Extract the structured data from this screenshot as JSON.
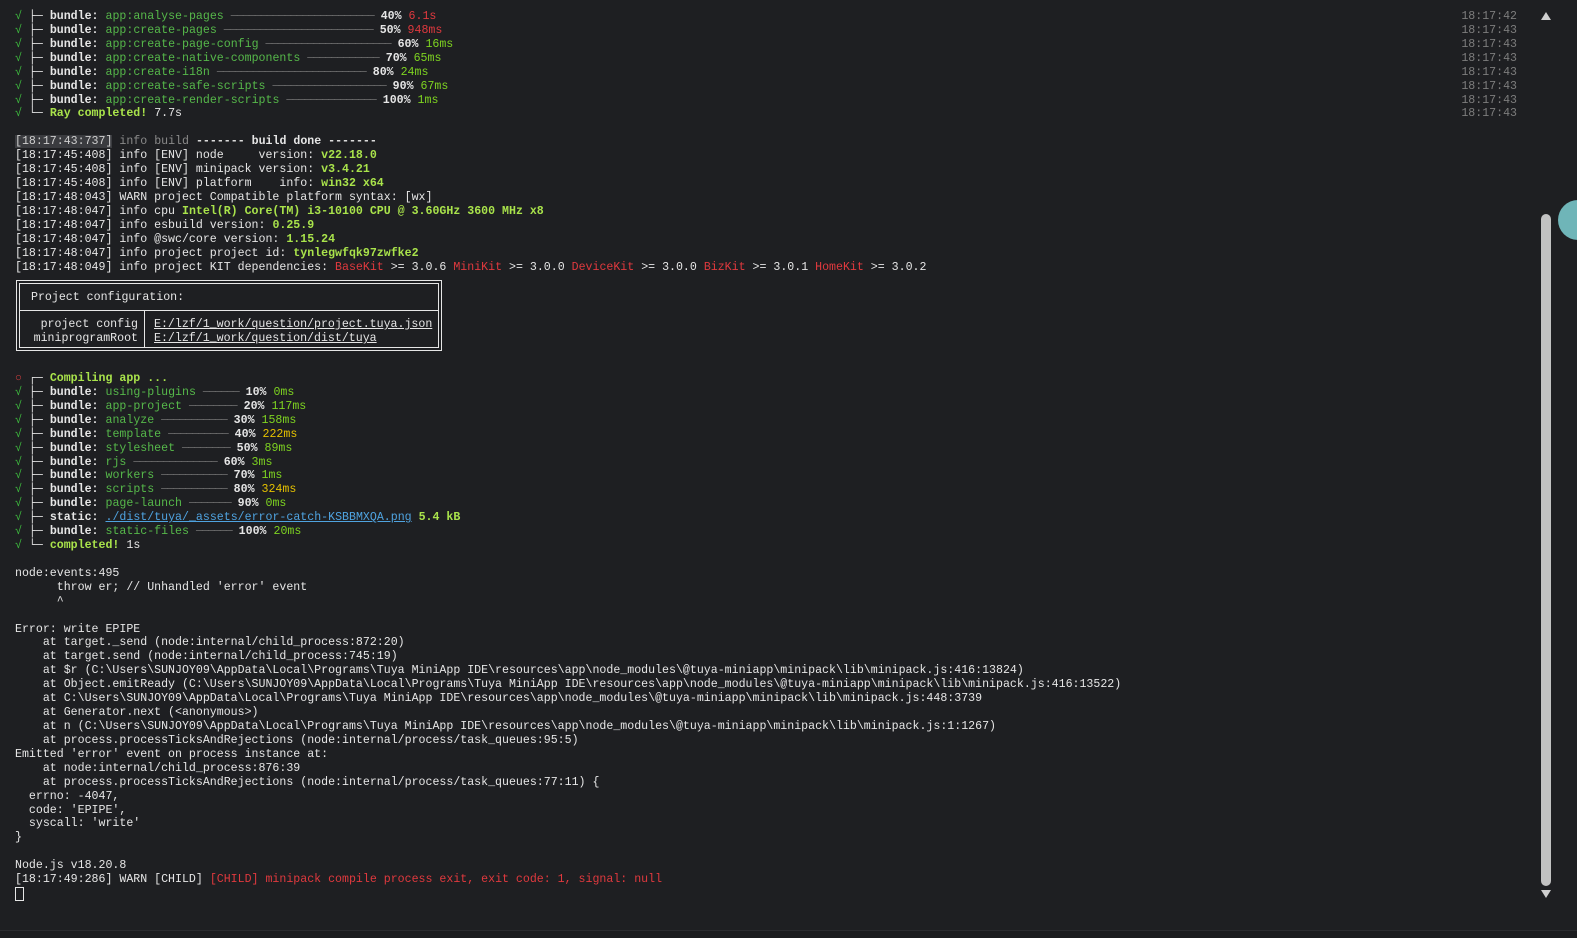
{
  "colors": {
    "background": "#1e1f22",
    "success": "#3fbf3f",
    "package": "#56b84a",
    "fast": "#7ed321",
    "medium": "#e5c100",
    "slow": "#e0393e",
    "timestamp": "#7d7d7d"
  },
  "icons": {
    "success": "√",
    "pending": "○",
    "scroll_up": "triangle-up-icon",
    "scroll_down": "triangle-down-icon"
  },
  "top_bundles": [
    {
      "label": "bundle:",
      "name": "app:analyse-pages",
      "bar": "────────────────────────",
      "pct": "40%",
      "time": "6.1s",
      "speed": "slow",
      "ts": "18:17:42"
    },
    {
      "label": "bundle:",
      "name": "app:create-pages",
      "bar": "─────────────────────────",
      "pct": "50%",
      "time": "948ms",
      "speed": "slow",
      "ts": "18:17:43"
    },
    {
      "label": "bundle:",
      "name": "app:create-page-config",
      "bar": "─────────────────────",
      "pct": "60%",
      "time": "16ms",
      "speed": "fast",
      "ts": "18:17:43"
    },
    {
      "label": "bundle:",
      "name": "app:create-native-components",
      "bar": "────────────",
      "pct": "70%",
      "time": "65ms",
      "speed": "fast",
      "ts": "18:17:43"
    },
    {
      "label": "bundle:",
      "name": "app:create-i18n",
      "bar": "─────────────────────────",
      "pct": "80%",
      "time": "24ms",
      "speed": "fast",
      "ts": "18:17:43"
    },
    {
      "label": "bundle:",
      "name": "app:create-safe-scripts",
      "bar": "───────────────────",
      "pct": "90%",
      "time": "67ms",
      "speed": "fast",
      "ts": "18:17:43"
    },
    {
      "label": "bundle:",
      "name": "app:create-render-scripts",
      "bar": "───────────────",
      "pct": "100%",
      "time": "1ms",
      "speed": "fast",
      "ts": "18:17:43"
    }
  ],
  "ray_completed": {
    "text": "Ray completed!",
    "time": "7.7s",
    "ts": "18:17:43"
  },
  "log_build_done": {
    "stamp": "[18:17:43:737]",
    "level": "info",
    "tag": "build",
    "msg": "------- build done -------"
  },
  "env_logs": [
    {
      "prefix": "[18:17:45:408] info [ENV] node     version: ",
      "value": "v22.18.0"
    },
    {
      "prefix": "[18:17:45:408] info [ENV] minipack version: ",
      "value": "v3.4.21"
    },
    {
      "prefix": "[18:17:45:408] info [ENV] platform    info: ",
      "value": "win32 x64"
    },
    {
      "prefix": "[18:17:48:043] WARN project Compatible platform syntax: [wx]",
      "value": ""
    },
    {
      "prefix": "[18:17:48:047] info cpu ",
      "value": "Intel(R) Core(TM) i3-10100 CPU @ 3.60GHz 3600 MHz x8"
    },
    {
      "prefix": "[18:17:48:047] info esbuild version: ",
      "value": "0.25.9"
    },
    {
      "prefix": "[18:17:48:047] info @swc/core version: ",
      "value": "1.15.24"
    },
    {
      "prefix": "[18:17:48:047] info project project id: ",
      "value": "tynlegwfqk97zwfke2"
    }
  ],
  "kit_deps": {
    "prefix": "[18:17:48:049] info project KIT dependencies: ",
    "items": [
      {
        "name": "BaseKit",
        "ver": " >= 3.0.6 "
      },
      {
        "name": "MiniKit",
        "ver": " >= 3.0.0 "
      },
      {
        "name": "DeviceKit",
        "ver": " >= 3.0.0 "
      },
      {
        "name": "BizKit",
        "ver": " >= 3.0.1 "
      },
      {
        "name": "HomeKit",
        "ver": " >= 3.0.2"
      }
    ]
  },
  "project_config": {
    "title": "Project configuration:",
    "rows": [
      {
        "key": "project config",
        "value": "E:/lzf/1_work/question/project.tuya.json"
      },
      {
        "key": "miniprogramRoot",
        "value": "E:/lzf/1_work/question/dist/tuya"
      }
    ]
  },
  "compiling": {
    "text": "Compiling app ..."
  },
  "app_bundles": [
    {
      "kind": "bundle:",
      "name": "using-plugins",
      "bar": "──────",
      "pct": "10%",
      "time": "0ms",
      "speed": "fast"
    },
    {
      "kind": "bundle:",
      "name": "app-project",
      "bar": "────────",
      "pct": "20%",
      "time": "117ms",
      "speed": "fast"
    },
    {
      "kind": "bundle:",
      "name": "analyze",
      "bar": "───────────",
      "pct": "30%",
      "time": "158ms",
      "speed": "fast"
    },
    {
      "kind": "bundle:",
      "name": "template",
      "bar": "──────────",
      "pct": "40%",
      "time": "222ms",
      "speed": "medium"
    },
    {
      "kind": "bundle:",
      "name": "stylesheet",
      "bar": "────────",
      "pct": "50%",
      "time": "89ms",
      "speed": "fast"
    },
    {
      "kind": "bundle:",
      "name": "rjs",
      "bar": "──────────────",
      "pct": "60%",
      "time": "3ms",
      "speed": "fast"
    },
    {
      "kind": "bundle:",
      "name": "workers",
      "bar": "───────────",
      "pct": "70%",
      "time": "1ms",
      "speed": "fast"
    },
    {
      "kind": "bundle:",
      "name": "scripts",
      "bar": "───────────",
      "pct": "80%",
      "time": "324ms",
      "speed": "medium"
    },
    {
      "kind": "bundle:",
      "name": "page-launch",
      "bar": "───────",
      "pct": "90%",
      "time": "0ms",
      "speed": "fast"
    }
  ],
  "static_line": {
    "kind": "static:",
    "path": "./dist/tuya/_assets/error-catch-KSBBMXQA.png",
    "size": "5.4 kB"
  },
  "static_files": {
    "kind": "bundle:",
    "name": "static-files",
    "bar": "──────",
    "pct": "100%",
    "time": "20ms"
  },
  "completed": {
    "text": "completed!",
    "time": "1s"
  },
  "error_block": [
    "node:events:495",
    "      throw er; // Unhandled 'error' event",
    "      ^",
    "",
    "Error: write EPIPE",
    "    at target._send (node:internal/child_process:872:20)",
    "    at target.send (node:internal/child_process:745:19)",
    "    at $r (C:\\Users\\SUNJOY09\\AppData\\Local\\Programs\\Tuya MiniApp IDE\\resources\\app\\node_modules\\@tuya-miniapp\\minipack\\lib\\minipack.js:416:13824)",
    "    at Object.emitReady (C:\\Users\\SUNJOY09\\AppData\\Local\\Programs\\Tuya MiniApp IDE\\resources\\app\\node_modules\\@tuya-miniapp\\minipack\\lib\\minipack.js:416:13522)",
    "    at C:\\Users\\SUNJOY09\\AppData\\Local\\Programs\\Tuya MiniApp IDE\\resources\\app\\node_modules\\@tuya-miniapp\\minipack\\lib\\minipack.js:448:3739",
    "    at Generator.next (<anonymous>)",
    "    at n (C:\\Users\\SUNJOY09\\AppData\\Local\\Programs\\Tuya MiniApp IDE\\resources\\app\\node_modules\\@tuya-miniapp\\minipack\\lib\\minipack.js:1:1267)",
    "    at process.processTicksAndRejections (node:internal/process/task_queues:95:5)",
    "Emitted 'error' event on process instance at:",
    "    at node:internal/child_process:876:39",
    "    at process.processTicksAndRejections (node:internal/process/task_queues:77:11) {",
    "  errno: -4047,",
    "  code: 'EPIPE',",
    "  syscall: 'write'",
    "}",
    "",
    "Node.js v18.20.8"
  ],
  "final_warn": {
    "prefix": "[18:17:49:286] WARN [CHILD] ",
    "msg": "[CHILD] minipack compile process exit, exit code: 1, signal: null"
  },
  "scroll": {
    "position": 0.22,
    "visible_fraction": 0.78
  }
}
